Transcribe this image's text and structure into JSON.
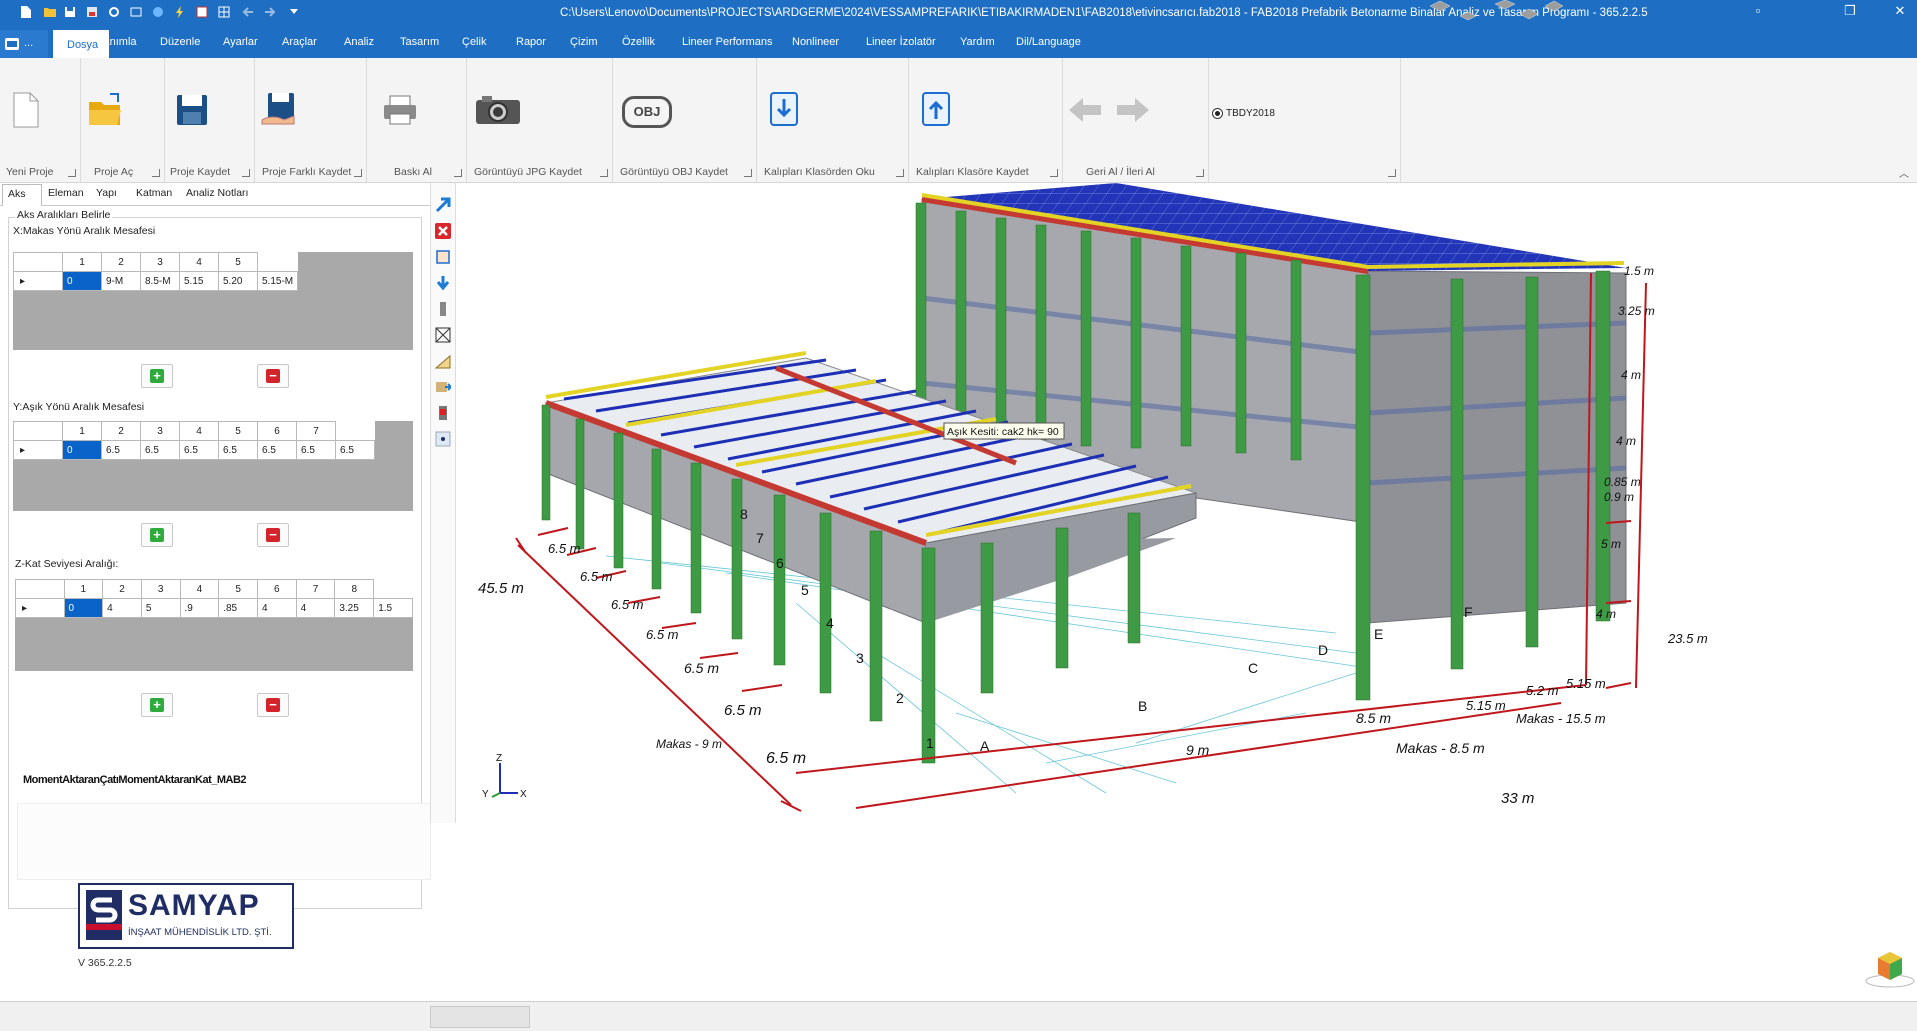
{
  "titlebar": {
    "title": "C:\\Users\\Lenovo\\Documents\\PROJECTS\\ARDGERME\\2024\\VESSAMPREFARIK\\ETIBAKIRMADEN1\\FAB2018\\etivincsarıcı.fab2018 - FAB2018 Prefabrik Betonarme Binalar Analiz ve Tasarım Programı - 365.2.2.5"
  },
  "menu": {
    "app_label": "...",
    "items": [
      "Dosya",
      "Tanımla",
      "Düzenle",
      "Ayarlar",
      "Araçlar",
      "Analiz",
      "Tasarım",
      "Çelik",
      "Rapor",
      "Çizim",
      "Özellik",
      "Lineer Performans",
      "Nonlineer",
      "Lineer İzolatör",
      "Yardım",
      "Dil/Language"
    ]
  },
  "ribbon": {
    "groups": [
      "Yeni Proje",
      "Proje Aç",
      "Proje Kaydet",
      "Proje Farklı Kaydet",
      "Baskı Al",
      "Görüntüyü JPG Kaydet",
      "Görüntüyü OBJ Kaydet",
      "Kalıpları Klasörden Oku",
      "Kalıpları Klasöre Kaydet",
      "Geri Al / İleri Al"
    ],
    "obj_icon_text": "OBJ",
    "radio_label": "TBDY2018"
  },
  "left_panel": {
    "tabs": [
      "Aks",
      "Eleman",
      "Yapı",
      "Katman",
      "Analiz Notları"
    ],
    "group_title": "Aks Aralıkları Belirle",
    "x_section": {
      "title": "X:Makas Yönü Aralık Mesafesi",
      "headers": [
        "1",
        "2",
        "3",
        "4",
        "5"
      ],
      "row_index": "0",
      "values": [
        "9-M",
        "8.5-M",
        "5.15",
        "5.20",
        "5.15-M"
      ]
    },
    "y_section": {
      "title": "Y:Aşık Yönü Aralık Mesafesi",
      "headers": [
        "1",
        "2",
        "3",
        "4",
        "5",
        "6",
        "7"
      ],
      "row_index": "0",
      "values": [
        "6.5",
        "6.5",
        "6.5",
        "6.5",
        "6.5",
        "6.5",
        "6.5"
      ]
    },
    "z_section": {
      "title": "Z-Kat Seviyesi Aralığı:",
      "headers": [
        "1",
        "2",
        "3",
        "4",
        "5",
        "6",
        "7",
        "8"
      ],
      "row_index": "0",
      "values": [
        "4",
        "5",
        ".9",
        ".85",
        "4",
        "4",
        "3.25",
        "1.5"
      ]
    },
    "add_symbol": "+",
    "remove_symbol": "−",
    "section_label": "MomentAktaranÇatıMomentAktaranKat_MAB2",
    "logo_name": "SAMYAP",
    "logo_subtitle": "İNŞAAT MÜHENDİSLİK LTD. ŞTİ.",
    "version": "V 365.2.2.5"
  },
  "viewport": {
    "tooltip": "Aşık Kesiti: cak2 hk= 90",
    "y_dims": [
      "6.5 m",
      "6.5 m",
      "6.5 m",
      "6.5 m",
      "6.5 m",
      "6.5 m",
      "6.5 m"
    ],
    "y_total": "45.5 m",
    "x_dims": [
      "9 m",
      "8.5 m",
      "5.15 m",
      "5.2 m",
      "5.15 m"
    ],
    "makas_dims": [
      "Makas - 9 m",
      "Makas - 8.5 m",
      "Makas - 15.5 m"
    ],
    "x_total": "33 m",
    "z_dims": [
      "1.5 m",
      "3.25 m",
      "4 m",
      "4 m",
      "0.85 m",
      "0.9 m",
      "5 m",
      "4 m"
    ],
    "z_total": "23.5 m",
    "axis_numbers": [
      "1",
      "2",
      "3",
      "4",
      "5",
      "6",
      "7",
      "8"
    ],
    "axis_letters": [
      "A",
      "B",
      "C",
      "D",
      "E",
      "F"
    ],
    "triad": {
      "z": "Z",
      "y": "Y",
      "x": "X"
    },
    "colors": {
      "column": "#3f9a45",
      "wall": "#a5a7ad",
      "roof_purlin": "#1d2fb5",
      "beam_red": "#c43a32",
      "beam_yellow": "#e2d324",
      "dimension": "#c0171c"
    }
  }
}
